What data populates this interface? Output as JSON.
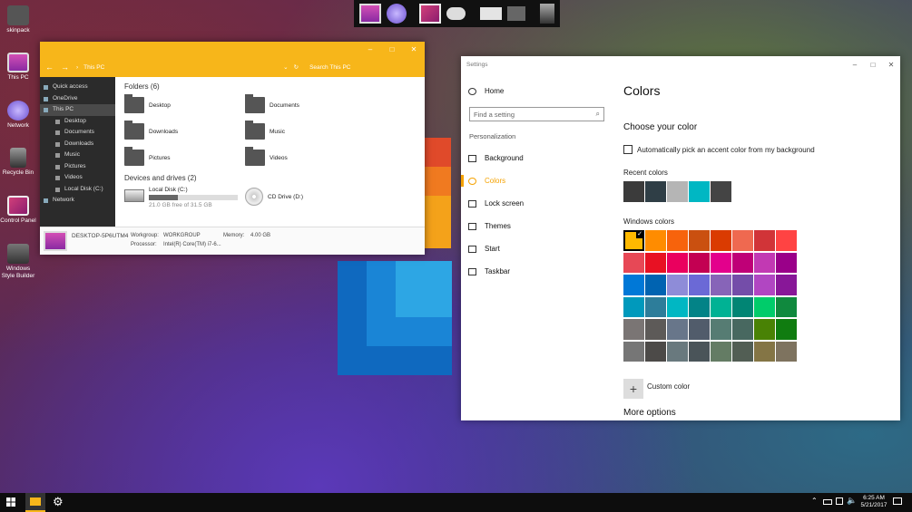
{
  "desktop": {
    "icons": [
      {
        "label": "skinpack",
        "icon": "folder-icon"
      },
      {
        "label": "This PC",
        "icon": "monitor-icon"
      },
      {
        "label": "Network",
        "icon": "globe-icon"
      },
      {
        "label": "Recycle Bin",
        "icon": "trash-icon"
      },
      {
        "label": "Control Panel",
        "icon": "control-panel-icon"
      },
      {
        "label": "Windows Style Builder",
        "icon": "builder-icon"
      }
    ]
  },
  "dock": {
    "items": [
      "monitor-icon",
      "globe-icon",
      "control-panel-icon",
      "gamepad-icon",
      "drive-icon",
      "folder-icon",
      "trash-icon"
    ]
  },
  "explorer": {
    "title_controls": {
      "minimize": "–",
      "maximize": "□",
      "close": "✕"
    },
    "breadcrumb": "This PC",
    "search_placeholder": "Search This PC",
    "sidebar": [
      {
        "label": "Quick access",
        "level": 0
      },
      {
        "label": "OneDrive",
        "level": 0
      },
      {
        "label": "This PC",
        "level": 0,
        "selected": true
      },
      {
        "label": "Desktop",
        "level": 1
      },
      {
        "label": "Documents",
        "level": 1
      },
      {
        "label": "Downloads",
        "level": 1
      },
      {
        "label": "Music",
        "level": 1
      },
      {
        "label": "Pictures",
        "level": 1
      },
      {
        "label": "Videos",
        "level": 1
      },
      {
        "label": "Local Disk (C:)",
        "level": 1
      },
      {
        "label": "Network",
        "level": 0
      }
    ],
    "folders_header": "Folders (6)",
    "folders": [
      "Desktop",
      "Documents",
      "Downloads",
      "Music",
      "Pictures",
      "Videos"
    ],
    "drives_header": "Devices and drives (2)",
    "drives": [
      {
        "label": "Local Disk (C:)",
        "free": "21.0 GB free of 31.5 GB",
        "used_fraction": 0.33
      },
      {
        "label": "CD Drive (D:)"
      }
    ],
    "status": {
      "computer": "DESKTOP-5P6UTM4",
      "workgroup_label": "Workgroup:",
      "workgroup": "WORKGROUP",
      "memory_label": "Memory:",
      "memory": "4.00 GB",
      "processor_label": "Processor:",
      "processor": "Intel(R) Core(TM) i7-6..."
    }
  },
  "settings": {
    "window_title": "Settings",
    "controls": {
      "minimize": "–",
      "maximize": "□",
      "close": "✕"
    },
    "home": "Home",
    "search_placeholder": "Find a setting",
    "section": "Personalization",
    "nav": [
      {
        "label": "Background",
        "icon": "picture-icon"
      },
      {
        "label": "Colors",
        "icon": "palette-icon",
        "active": true
      },
      {
        "label": "Lock screen",
        "icon": "lock-screen-icon"
      },
      {
        "label": "Themes",
        "icon": "themes-icon"
      },
      {
        "label": "Start",
        "icon": "start-icon"
      },
      {
        "label": "Taskbar",
        "icon": "taskbar-icon"
      }
    ],
    "page_title": "Colors",
    "choose_header": "Choose your color",
    "auto_checkbox_label": "Automatically pick an accent color from my background",
    "auto_checked": false,
    "recent_header": "Recent colors",
    "recent_colors": [
      "#3b3b3b",
      "#2f3e46",
      "#b5b5b5",
      "#00b7c3",
      "#444444"
    ],
    "windows_header": "Windows colors",
    "windows_colors": [
      [
        "#ffb900",
        "#ff8c00",
        "#f7630c",
        "#ca5010",
        "#da3b01",
        "#ef6950",
        "#d13438",
        "#ff4343"
      ],
      [
        "#e74856",
        "#e81123",
        "#ea005e",
        "#c30052",
        "#e3008c",
        "#bf0077",
        "#c239b3",
        "#9a0089"
      ],
      [
        "#0078d7",
        "#0063b1",
        "#8e8cd8",
        "#6b69d6",
        "#8764b8",
        "#744da9",
        "#b146c2",
        "#881798"
      ],
      [
        "#0099bc",
        "#2d7d9a",
        "#00b7c3",
        "#038387",
        "#00b294",
        "#018574",
        "#00cc6a",
        "#10893e"
      ],
      [
        "#7a7574",
        "#5d5a58",
        "#68768a",
        "#515c6b",
        "#567c73",
        "#486860",
        "#498205",
        "#107c10"
      ],
      [
        "#767676",
        "#4c4a48",
        "#69797e",
        "#4a5459",
        "#647c64",
        "#525e54",
        "#847545",
        "#7e735f"
      ]
    ],
    "selected_color": [
      0,
      0
    ],
    "custom_label": "Custom color",
    "custom_icon": "plus-icon",
    "more_options": "More options"
  },
  "taskbar": {
    "time": "6:25 AM",
    "date": "5/21/2017",
    "pinned": [
      "start-icon",
      "file-explorer-icon",
      "settings-gear-icon"
    ],
    "tray": [
      "chevron-up-icon",
      "battery-icon",
      "network-icon",
      "volume-icon",
      "notification-icon"
    ]
  }
}
